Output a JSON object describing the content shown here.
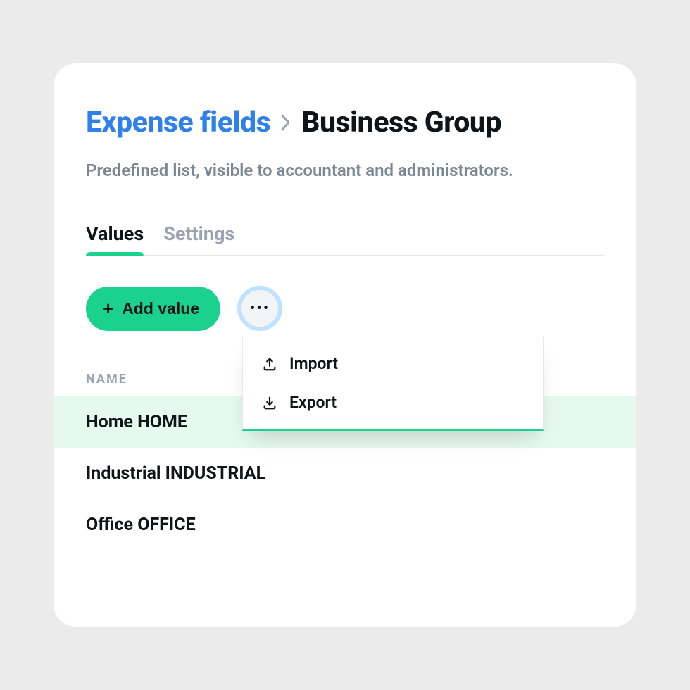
{
  "breadcrumb": {
    "root": "Expense fields",
    "current": "Business Group"
  },
  "subtitle": "Predefined list, visible to accountant and administrators.",
  "tabs": {
    "values": "Values",
    "settings": "Settings"
  },
  "toolbar": {
    "add_value": "Add value"
  },
  "menu": {
    "import": "Import",
    "export": "Export"
  },
  "table": {
    "column_name": "NAME",
    "rows": [
      "Home HOME",
      "Industrial INDUSTRIAL",
      "Office OFFICE"
    ]
  },
  "colors": {
    "accent_green": "#1ad18e",
    "link_blue": "#2f80ed",
    "focus_ring": "#bfe3ff"
  }
}
